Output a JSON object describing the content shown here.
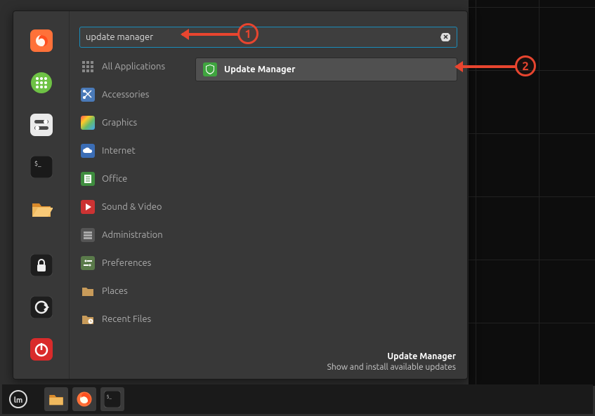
{
  "search": {
    "value": "update manager"
  },
  "favorites": [
    {
      "name": "firefox",
      "color": "#ff7139"
    },
    {
      "name": "apps-grid",
      "color": "#6ec245"
    },
    {
      "name": "settings-toggle",
      "color": "#eeeeee"
    },
    {
      "name": "terminal",
      "color": "#202020"
    },
    {
      "name": "files",
      "color": "#f0a84b"
    },
    {
      "name": "lock",
      "color": "#2b2b2b"
    },
    {
      "name": "logout",
      "color": "#2b2b2b"
    },
    {
      "name": "power",
      "color": "#e03030"
    }
  ],
  "categories": [
    {
      "id": "all",
      "label": "All Applications"
    },
    {
      "id": "accessories",
      "label": "Accessories"
    },
    {
      "id": "graphics",
      "label": "Graphics"
    },
    {
      "id": "internet",
      "label": "Internet"
    },
    {
      "id": "office",
      "label": "Office"
    },
    {
      "id": "sound-video",
      "label": "Sound & Video"
    },
    {
      "id": "administration",
      "label": "Administration"
    },
    {
      "id": "preferences",
      "label": "Preferences"
    },
    {
      "id": "places",
      "label": "Places"
    },
    {
      "id": "recent-files",
      "label": "Recent Files"
    }
  ],
  "result": {
    "label": "Update Manager"
  },
  "description": {
    "title": "Update Manager",
    "body": "Show and install available updates"
  },
  "panel": [
    {
      "name": "mint-menu"
    },
    {
      "name": "files"
    },
    {
      "name": "firefox"
    },
    {
      "name": "terminal"
    }
  ],
  "annotations": {
    "step1": "1",
    "step2": "2"
  }
}
